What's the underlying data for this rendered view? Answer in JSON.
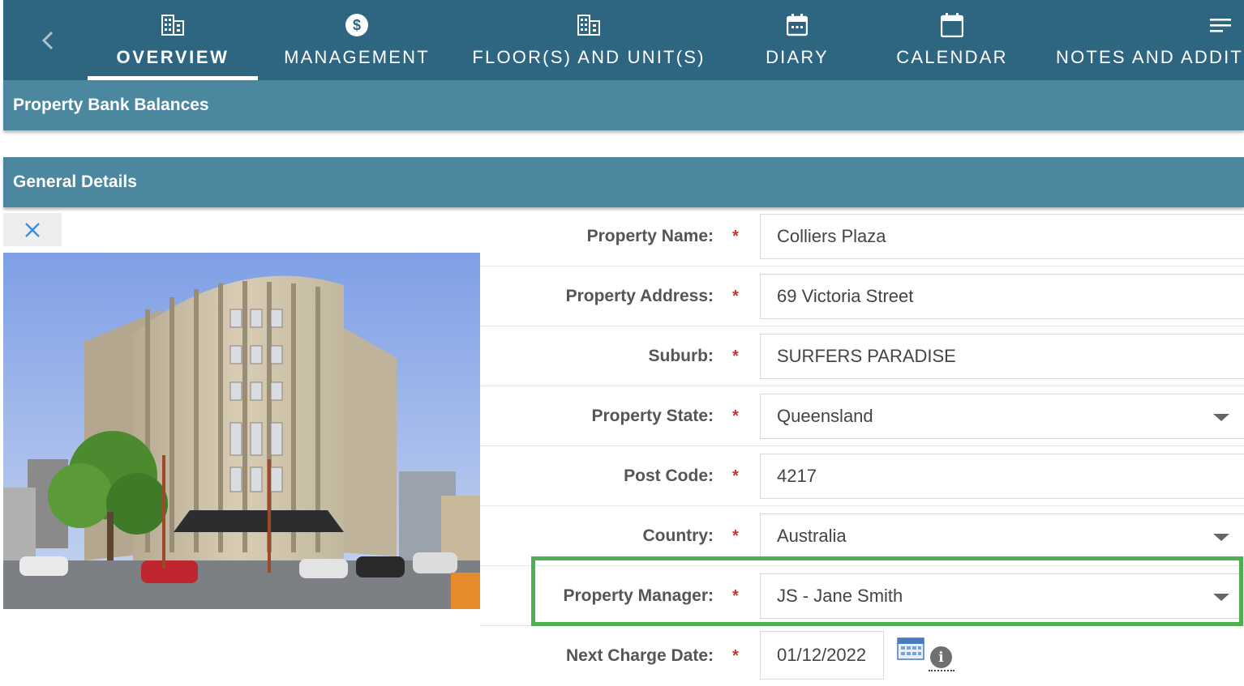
{
  "nav": {
    "tabs": [
      {
        "label": "OVERVIEW",
        "icon": "building-icon",
        "active": true
      },
      {
        "label": "MANAGEMENT",
        "icon": "dollar-circle-icon",
        "active": false
      },
      {
        "label": "FLOOR(S) AND UNIT(S)",
        "icon": "building-icon",
        "active": false
      },
      {
        "label": "DIARY",
        "icon": "calendar-dots-icon",
        "active": false
      },
      {
        "label": "CALENDAR",
        "icon": "calendar-icon",
        "active": false
      },
      {
        "label": "NOTES AND ADDITI",
        "icon": "notes-lines-icon",
        "active": false
      }
    ]
  },
  "sections": {
    "bank_balances": "Property Bank Balances",
    "general_details": "General Details"
  },
  "form": {
    "property_name": {
      "label": "Property Name:",
      "value": "Colliers Plaza"
    },
    "property_address": {
      "label": "Property Address:",
      "value": "69 Victoria Street"
    },
    "suburb": {
      "label": "Suburb:",
      "value": "SURFERS PARADISE"
    },
    "property_state": {
      "label": "Property State:",
      "value": "Queensland"
    },
    "post_code": {
      "label": "Post Code:",
      "value": "4217"
    },
    "country": {
      "label": "Country:",
      "value": "Australia"
    },
    "property_manager": {
      "label": "Property Manager:",
      "value": "JS - Jane Smith"
    },
    "next_charge_date": {
      "label": "Next Charge Date:",
      "value": "01/12/2022"
    },
    "required_marker": "*"
  },
  "colors": {
    "nav_bg": "#2e6681",
    "section_bg": "#4b879f",
    "highlight": "#4caf50",
    "required": "#d0302a"
  },
  "info_icon_glyph": "i"
}
